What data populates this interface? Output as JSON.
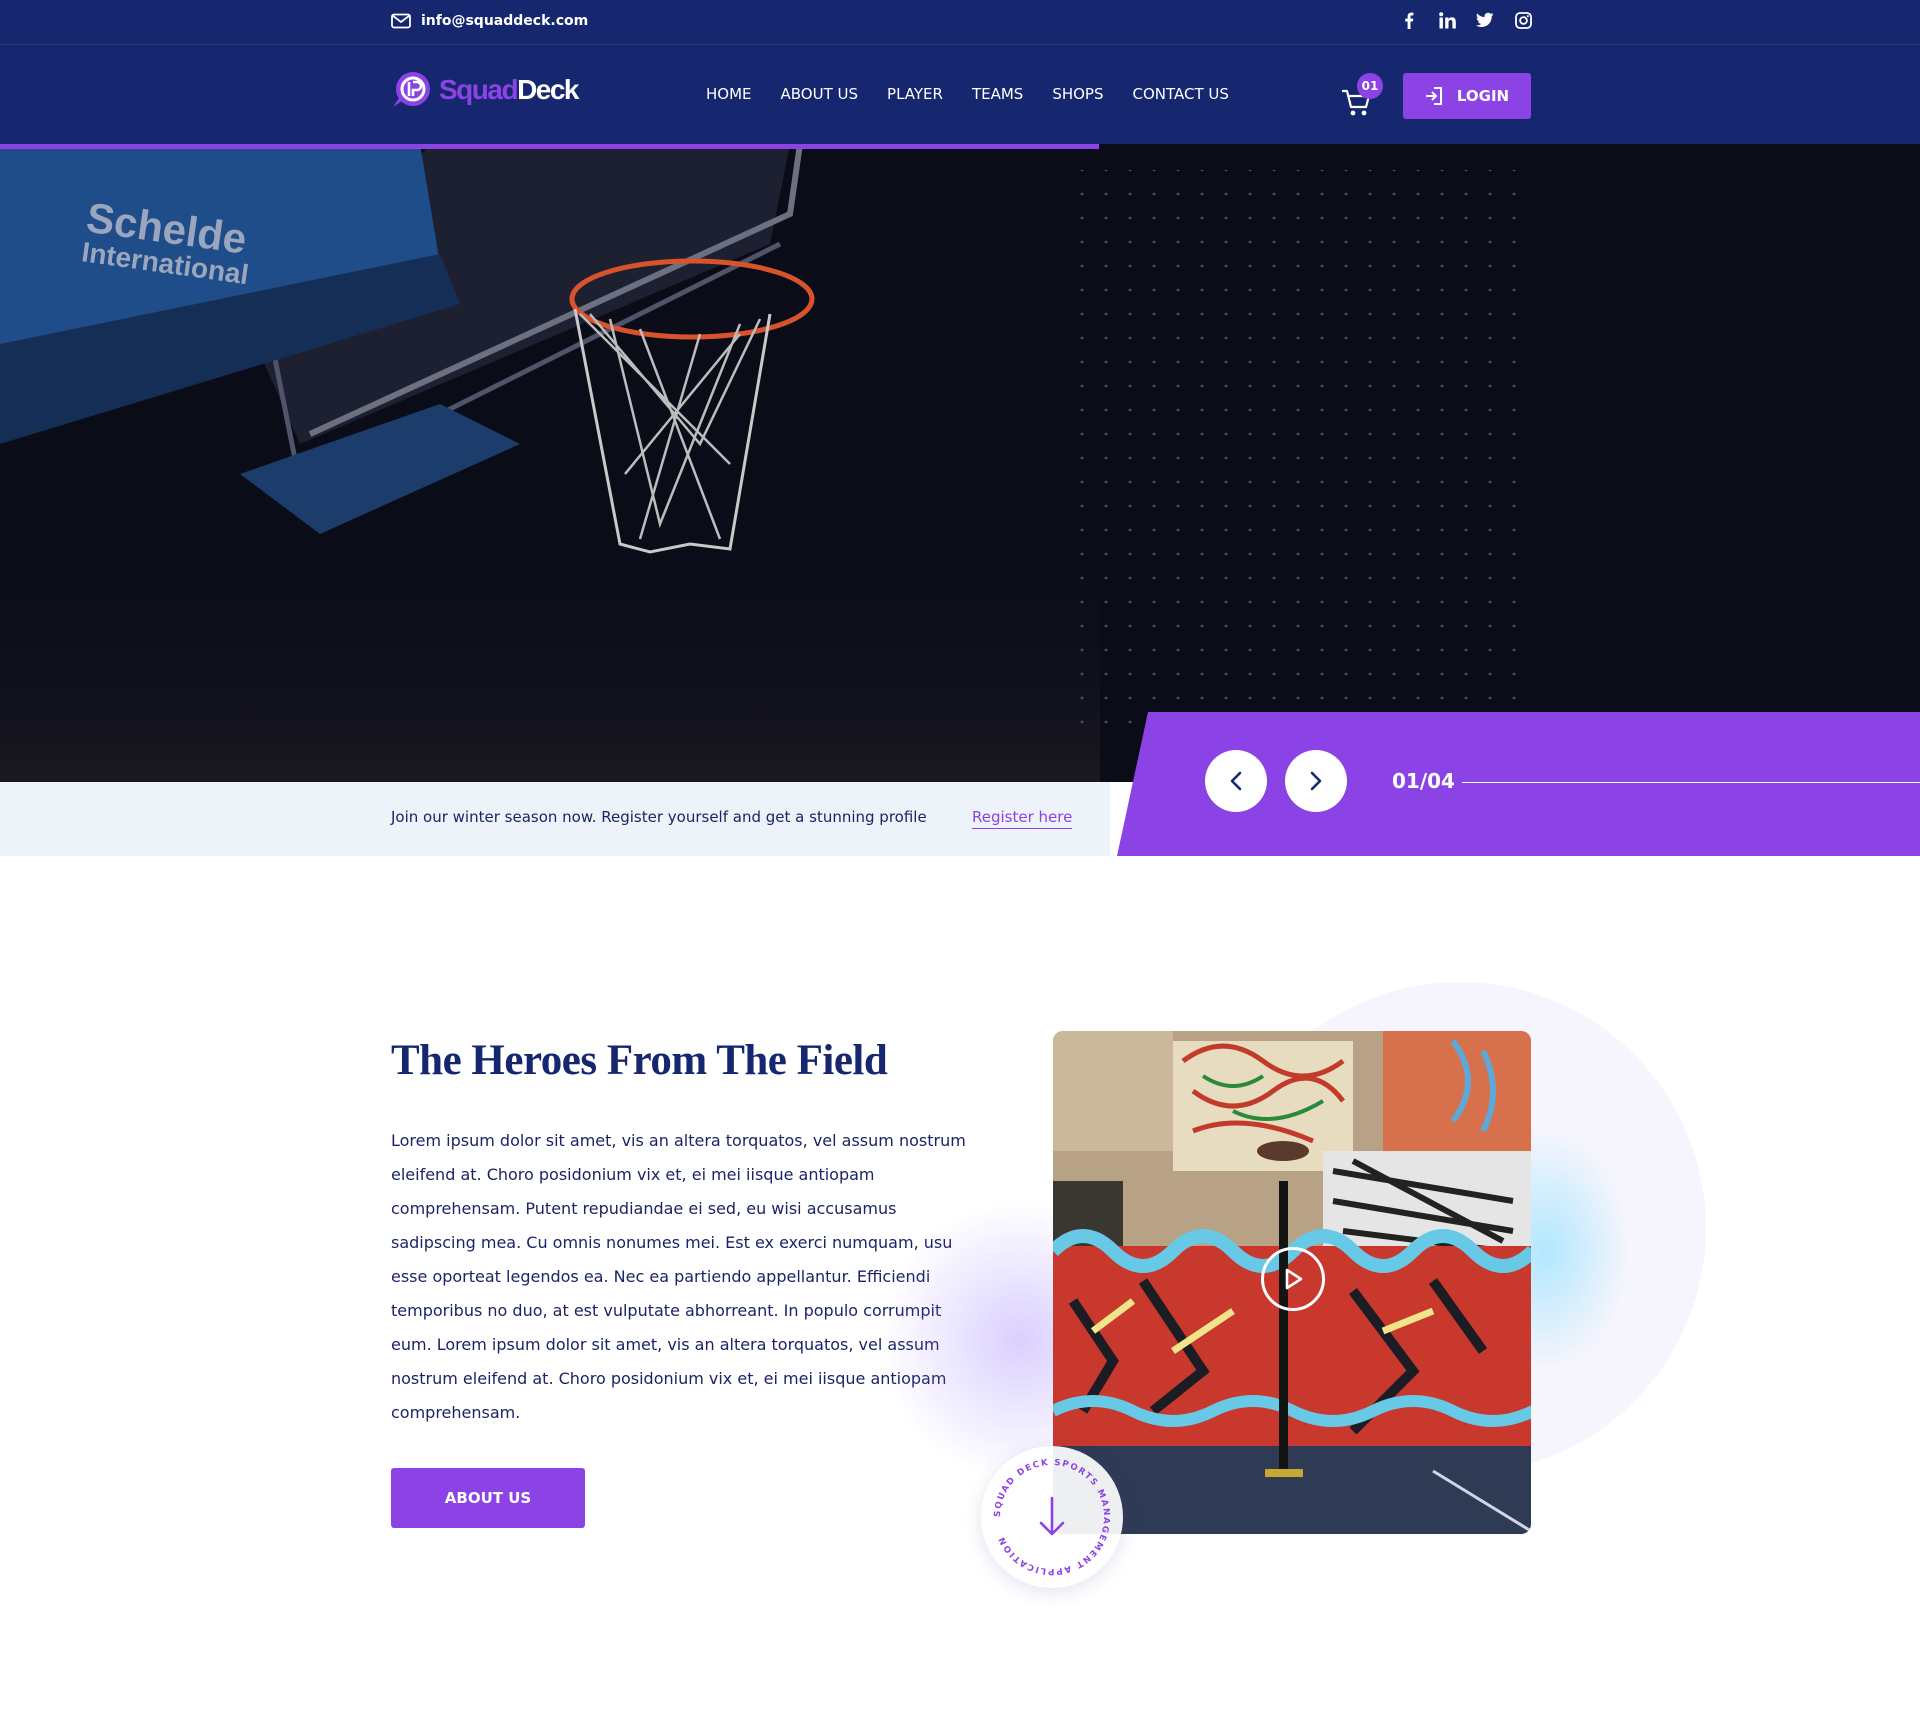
{
  "topbar": {
    "email": "info@squaddeck.com",
    "social": [
      "facebook-icon",
      "linkedin-icon",
      "twitter-icon",
      "instagram-icon"
    ]
  },
  "brand": {
    "logo_part1": "Squad",
    "logo_part2": "Deck"
  },
  "nav": {
    "items": [
      "HOME",
      "ABOUT US",
      "PLAYER",
      "TEAMS",
      "SHOPS",
      "CONTACT US"
    ]
  },
  "cart": {
    "count": "01"
  },
  "login": {
    "label": "LOGIN"
  },
  "hero": {
    "banner_line1": "Schelde",
    "banner_line2": "International"
  },
  "strip": {
    "text": "Join our winter season now. Register yourself and get a stunning profile",
    "link": "Register here"
  },
  "slider": {
    "counter": "01/04"
  },
  "section": {
    "title": "The Heroes From The Field",
    "body": "Lorem ipsum dolor sit amet, vis an altera torquatos, vel assum nostrum eleifend at. Choro posidonium vix et, ei mei iisque antiopam comprehensam. Putent repudiandae ei sed, eu wisi accusamus sadipscing mea. Cu omnis nonumes mei. Est ex exerci numquam, usu esse oporteat legendos ea. Nec ea partiendo appellantur. Efficiendi temporibus no duo, at est vulputate abhorreant. In populo corrumpit eum. Lorem ipsum dolor sit amet, vis an altera torquatos, vel assum nostrum eleifend at. Choro posidonium vix et, ei mei iisque antiopam comprehensam.",
    "button": "ABOUT US",
    "badge_text": "SQUAD DECK SPORTS MANAGEMENT APPLICATION"
  },
  "colors": {
    "navy": "#16276f",
    "purple": "#8c43e6",
    "strip_bg": "#eef3fa"
  }
}
